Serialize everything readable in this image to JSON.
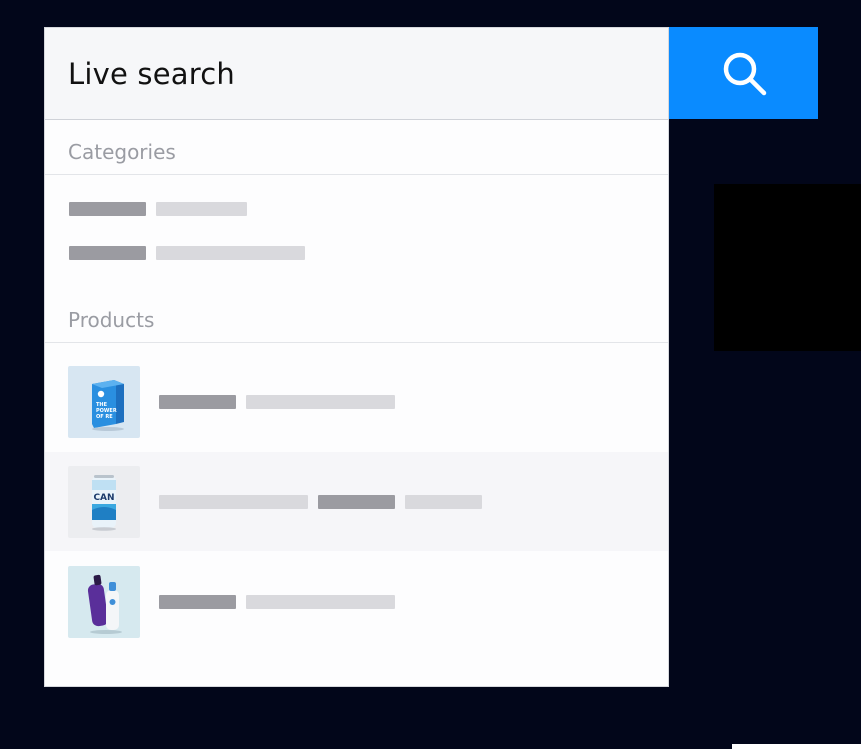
{
  "search": {
    "value": "Live search",
    "button_icon": "search-icon",
    "accent": "#0a8bff"
  },
  "sections": {
    "categories_label": "Categories",
    "products_label": "Products"
  },
  "categories": [
    {
      "placeholder_bars": [
        "dark",
        "light"
      ]
    },
    {
      "placeholder_bars": [
        "dark",
        "light"
      ]
    }
  ],
  "products": [
    {
      "thumb": "blue-box-product-image",
      "placeholder_bars": [
        "dark",
        "light"
      ]
    },
    {
      "thumb": "can-product-image",
      "placeholder_bars": [
        "light",
        "dark",
        "light"
      ]
    },
    {
      "thumb": "bottles-product-image",
      "placeholder_bars": [
        "dark",
        "light"
      ]
    }
  ],
  "product_text": {
    "box_line1": "THE",
    "box_line2": "POWER",
    "box_line3": "OF RE",
    "can_label": "CAN"
  }
}
